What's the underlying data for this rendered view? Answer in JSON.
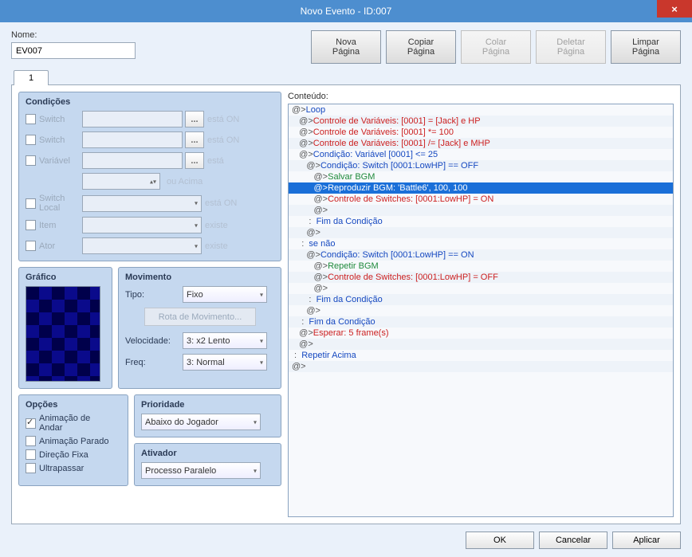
{
  "title": "Novo Evento - ID:007",
  "name_label": "Nome:",
  "name_value": "EV007",
  "buttons": {
    "new": "Nova\nPágina",
    "copy": "Copiar\nPágina",
    "paste": "Colar\nPágina",
    "delete": "Deletar\nPágina",
    "clear": "Limpar\nPágina"
  },
  "tab1": "1",
  "conditions": {
    "title": "Condições",
    "switch": "Switch",
    "variable": "Variável",
    "switch_local": "Switch\nLocal",
    "item": "Item",
    "actor": "Ator",
    "tail_on": "está ON",
    "tail_is": "está",
    "tail_or_above": "ou Acima",
    "tail_exists": "existe"
  },
  "graphic_title": "Gráfico",
  "movement": {
    "title": "Movimento",
    "type_label": "Tipo:",
    "type_value": "Fixo",
    "route_btn": "Rota de Movimento...",
    "speed_label": "Velocidade:",
    "speed_value": "3: x2 Lento",
    "freq_label": "Freq:",
    "freq_value": "3: Normal"
  },
  "options": {
    "title": "Opções",
    "walk_anim": "Animação de\nAndar",
    "stop_anim": "Animação Parado",
    "dir_fix": "Direção Fixa",
    "through": "Ultrapassar"
  },
  "priority": {
    "title": "Prioridade",
    "value": "Abaixo do Jogador"
  },
  "trigger": {
    "title": "Ativador",
    "value": "Processo Paralelo"
  },
  "content_label": "Conteúdo:",
  "content": [
    {
      "indent": 0,
      "cls": "c-blue",
      "text": "Loop"
    },
    {
      "indent": 1,
      "cls": "c-red",
      "text": "Controle de Variáveis: [0001] = [Jack] e HP"
    },
    {
      "indent": 1,
      "cls": "c-red",
      "text": "Controle de Variáveis: [0001] *= 100"
    },
    {
      "indent": 1,
      "cls": "c-red",
      "text": "Controle de Variáveis: [0001] /= [Jack] e MHP"
    },
    {
      "indent": 1,
      "cls": "c-blue",
      "text": "Condição: Variável [0001] <= 25"
    },
    {
      "indent": 2,
      "cls": "c-blue",
      "text": "Condição: Switch [0001:LowHP] == OFF"
    },
    {
      "indent": 3,
      "cls": "c-green",
      "text": "Salvar BGM"
    },
    {
      "indent": 3,
      "cls": "c-green",
      "text": "Reproduzir BGM: 'Battle6', 100, 100",
      "selected": true
    },
    {
      "indent": 3,
      "cls": "c-red",
      "text": "Controle de Switches: [0001:LowHP] = ON"
    },
    {
      "indent": 3,
      "cls": "",
      "text": "",
      "empty": true
    },
    {
      "indent": 2,
      "cls": "c-blue",
      "text": "Fim da Condição",
      "colon": true
    },
    {
      "indent": 2,
      "cls": "",
      "text": "",
      "empty": true
    },
    {
      "indent": 1,
      "cls": "c-blue",
      "text": "se não",
      "colon": true
    },
    {
      "indent": 2,
      "cls": "c-blue",
      "text": "Condição: Switch [0001:LowHP] == ON"
    },
    {
      "indent": 3,
      "cls": "c-green",
      "text": "Repetir BGM"
    },
    {
      "indent": 3,
      "cls": "c-red",
      "text": "Controle de Switches: [0001:LowHP] = OFF"
    },
    {
      "indent": 3,
      "cls": "",
      "text": "",
      "empty": true
    },
    {
      "indent": 2,
      "cls": "c-blue",
      "text": "Fim da Condição",
      "colon": true
    },
    {
      "indent": 2,
      "cls": "",
      "text": "",
      "empty": true
    },
    {
      "indent": 1,
      "cls": "c-blue",
      "text": "Fim da Condição",
      "colon": true
    },
    {
      "indent": 1,
      "cls": "c-red",
      "text": "Esperar: 5 frame(s)"
    },
    {
      "indent": 1,
      "cls": "",
      "text": "",
      "empty": true
    },
    {
      "indent": 0,
      "cls": "c-blue",
      "text": "Repetir Acima",
      "colon": true
    },
    {
      "indent": 0,
      "cls": "",
      "text": "",
      "empty": true,
      "noIndent": true
    }
  ],
  "footer": {
    "ok": "OK",
    "cancel": "Cancelar",
    "apply": "Aplicar"
  }
}
